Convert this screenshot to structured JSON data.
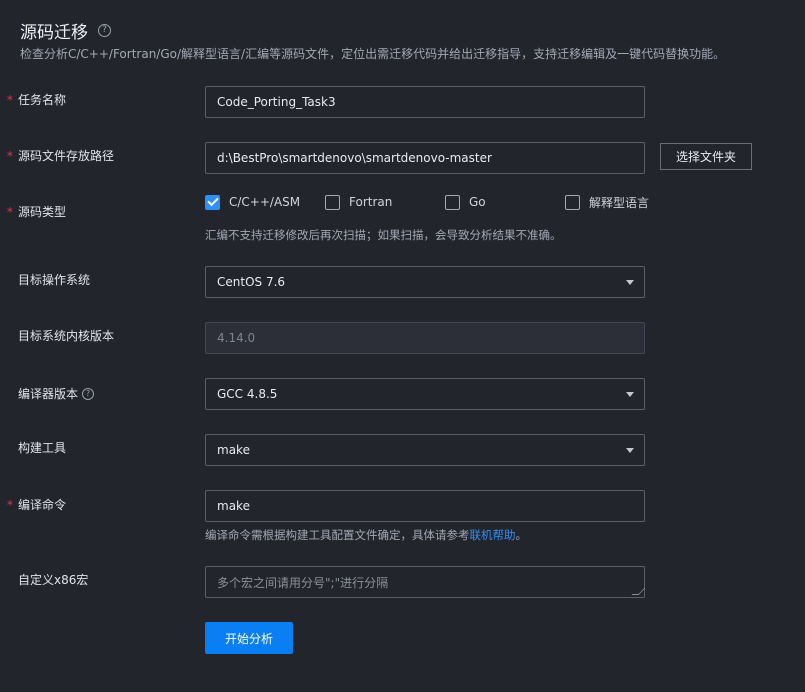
{
  "page": {
    "title": "源码迁移",
    "subtitle": "检查分析C/C++/Fortran/Go/解释型语言/汇编等源码文件，定位出需迁移代码并给出迁移指导，支持迁移编辑及一键代码替换功能。"
  },
  "icons": {
    "help": "?"
  },
  "form": {
    "task_name": {
      "label": "任务名称",
      "value": "Code_Porting_Task3",
      "required": true
    },
    "source_path": {
      "label": "源码文件存放路径",
      "value": "d:\\BestPro\\smartdenovo\\smartdenovo-master",
      "button": "选择文件夹",
      "required": true
    },
    "source_type": {
      "label": "源码类型",
      "required": true,
      "options": [
        {
          "label": "C/C++/ASM",
          "checked": true
        },
        {
          "label": "Fortran",
          "checked": false
        },
        {
          "label": "Go",
          "checked": false
        },
        {
          "label": "解释型语言",
          "checked": false
        }
      ],
      "hint": "汇编不支持迁移修改后再次扫描；如果扫描，会导致分析结果不准确。"
    },
    "target_os": {
      "label": "目标操作系统",
      "value": "CentOS 7.6"
    },
    "kernel_version": {
      "label": "目标系统内核版本",
      "value": "4.14.0"
    },
    "compiler_version": {
      "label": "编译器版本",
      "value": "GCC 4.8.5"
    },
    "build_tool": {
      "label": "构建工具",
      "value": "make"
    },
    "compile_cmd": {
      "label": "编译命令",
      "value": "make",
      "required": true,
      "hint_prefix": "编译命令需根据构建工具配置文件确定，具体请参考",
      "hint_link": "联机帮助",
      "hint_suffix": "。"
    },
    "x86_macro": {
      "label": "自定义x86宏",
      "placeholder": "多个宏之间请用分号\";\"进行分隔"
    }
  },
  "actions": {
    "start": "开始分析"
  },
  "colors": {
    "accent": "#0a7ef3",
    "required": "#e0364b",
    "background": "#23252d"
  }
}
